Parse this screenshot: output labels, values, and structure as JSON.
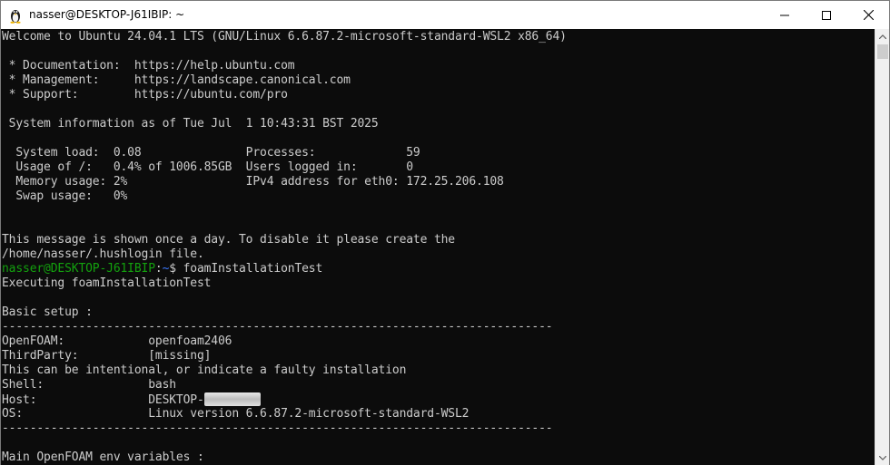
{
  "window": {
    "title": "nasser@DESKTOP-J61IBIP: ~",
    "icon": "linux-penguin-icon",
    "controls": [
      "minimize-icon",
      "maximize-icon",
      "close-icon"
    ]
  },
  "colors": {
    "background": "#0c0c0c",
    "text": "#cccccc",
    "prompt_user": "#13a10e",
    "prompt_path": "#3b78ff"
  },
  "terminal": {
    "welcome": "Welcome to Ubuntu 24.04.1 LTS (GNU/Linux 6.6.87.2-microsoft-standard-WSL2 x86_64)",
    "doc": " * Documentation:  https://help.ubuntu.com",
    "mgmt": " * Management:     https://landscape.canonical.com",
    "support": " * Support:        https://ubuntu.com/pro",
    "sysinfo": " System information as of Tue Jul  1 10:43:31 BST 2025",
    "sysload": "  System load:  0.08               Processes:             59",
    "usage": "  Usage of /:   0.4% of 1006.85GB  Users logged in:       0",
    "memory": "  Memory usage: 2%                 IPv4 address for eth0: 172.25.206.108",
    "swap": "  Swap usage:   0%",
    "msg1": "This message is shown once a day. To disable it please create the",
    "msg2": "/home/nasser/.hushlogin file.",
    "prompt_user": "nasser@DESKTOP-J61IBIP",
    "prompt_sep": ":",
    "prompt_path": "~",
    "prompt_dollar": "$ ",
    "command": "foamInstallationTest",
    "executing": "Executing foamInstallationTest",
    "basic_setup": "Basic setup :",
    "divider": "-------------------------------------------------------------------------------",
    "openfoam": "OpenFOAM:            openfoam2406",
    "thirdparty": "ThirdParty:          [missing]",
    "intentional": "This can be intentional, or indicate a faulty installation",
    "shell": "Shell:               bash",
    "host_label": "Host:                ",
    "host_value": "DESKTOP-",
    "os": "OS:                  Linux version 6.6.87.2-microsoft-standard-WSL2",
    "env_vars": "Main OpenFOAM env variables :"
  }
}
